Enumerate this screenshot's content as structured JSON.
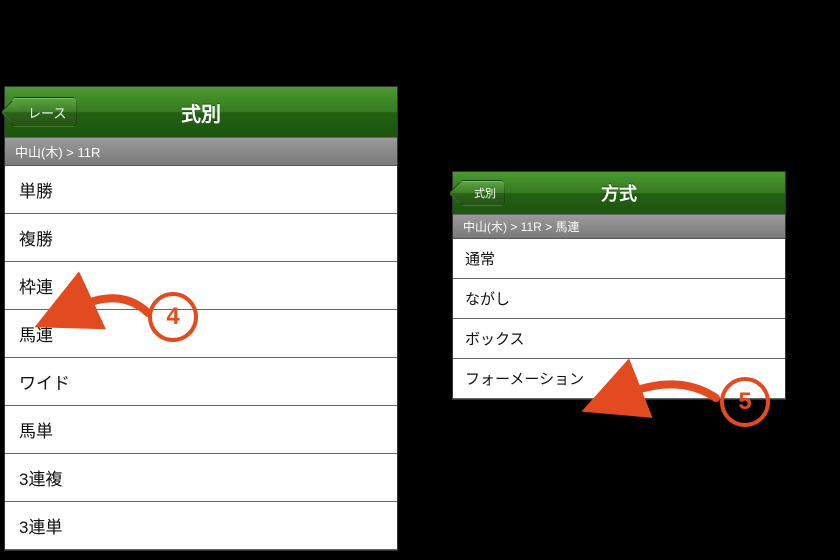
{
  "colors": {
    "accent": "#e24a1f",
    "nav_green": "#2e7d1e",
    "crumb_gray": "#888888"
  },
  "annotations": {
    "step4": "4",
    "step5": "5"
  },
  "panel_left": {
    "back_label": "レース",
    "title": "式別",
    "breadcrumb": "中山(木) > 11R",
    "items": [
      {
        "label": "単勝"
      },
      {
        "label": "複勝"
      },
      {
        "label": "枠連"
      },
      {
        "label": "馬連"
      },
      {
        "label": "ワイド"
      },
      {
        "label": "馬単"
      },
      {
        "label": "3連複"
      },
      {
        "label": "3連単"
      }
    ]
  },
  "panel_right": {
    "back_label": "式別",
    "title": "方式",
    "breadcrumb": "中山(木) > 11R > 馬連",
    "items": [
      {
        "label": "通常"
      },
      {
        "label": "ながし"
      },
      {
        "label": "ボックス"
      },
      {
        "label": "フォーメーション"
      }
    ]
  }
}
